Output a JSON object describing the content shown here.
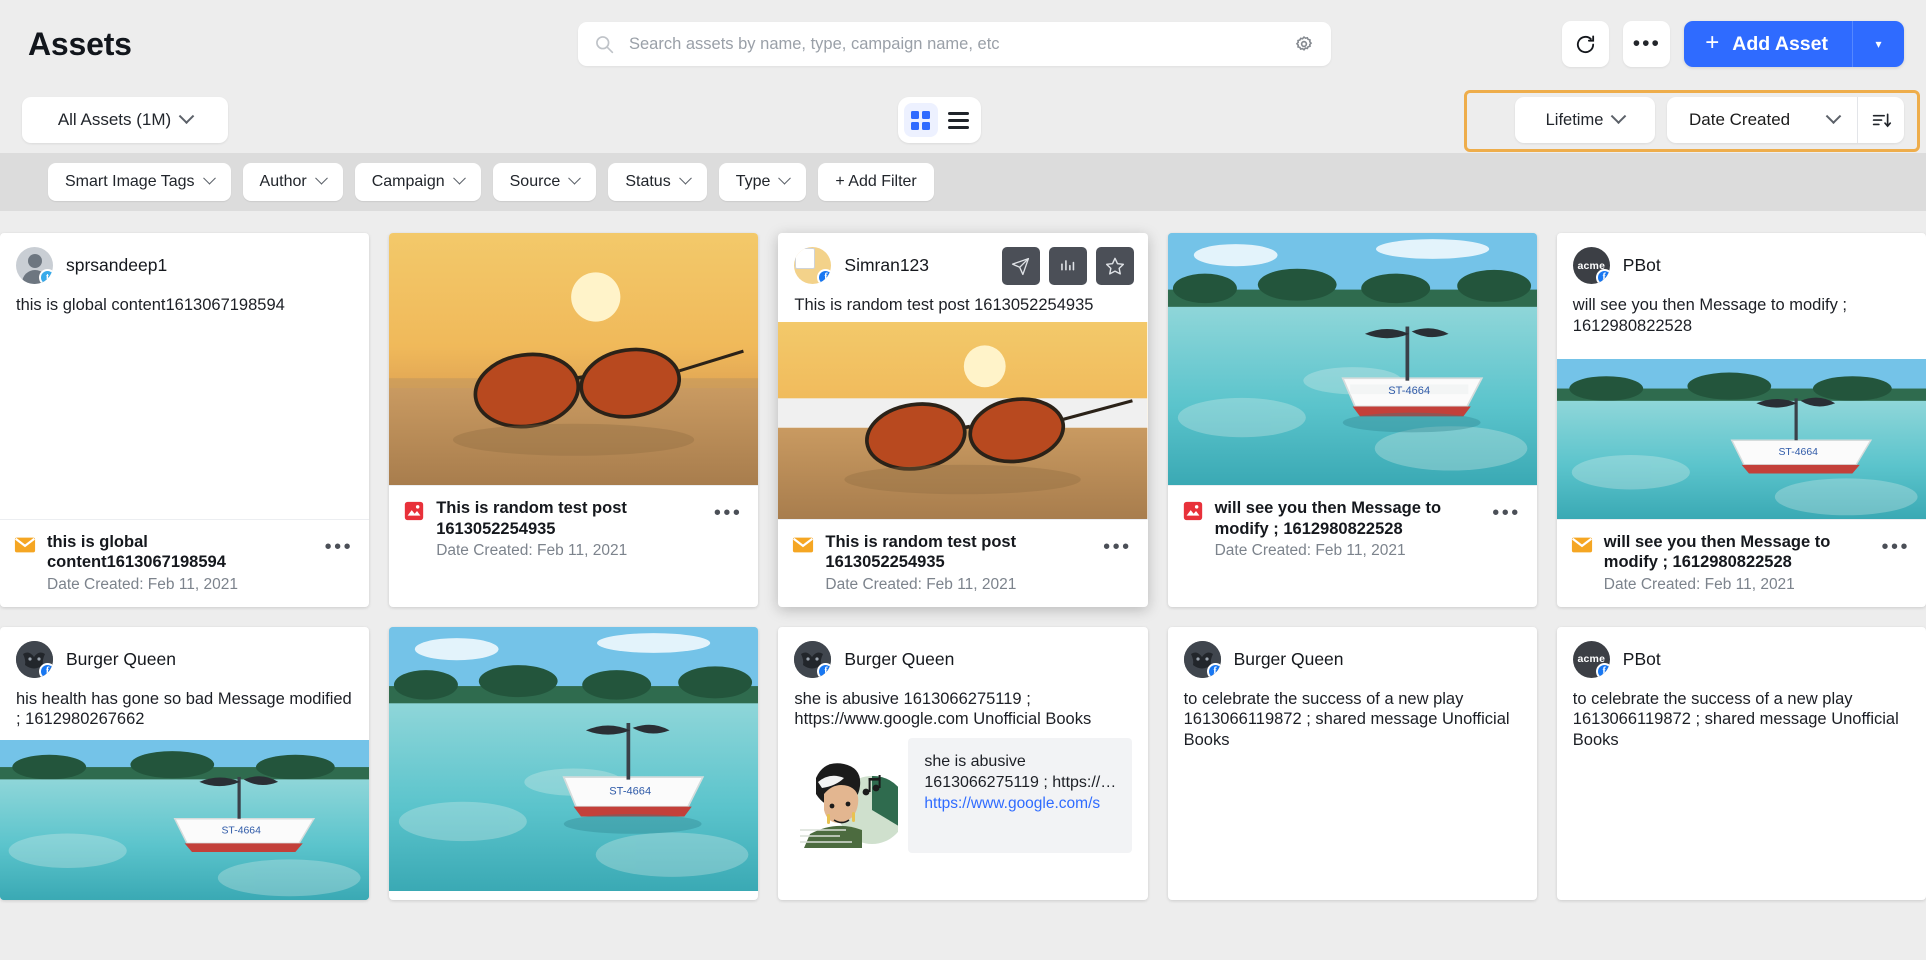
{
  "header": {
    "title": "Assets",
    "search": {
      "placeholder": "Search assets by name, type, campaign name, etc",
      "value": ""
    },
    "search_settings_icon": "gear-icon",
    "refresh_label": "refresh-icon",
    "more_label": "•••",
    "add_asset_label": "Add Asset",
    "add_asset_plus": "+",
    "add_asset_caret": "▾"
  },
  "subbar": {
    "all_assets_label": "All Assets (1M)",
    "view_grid": "grid-view",
    "view_list": "list-view",
    "lifetime_label": "Lifetime",
    "date_created_label": "Date Created",
    "sort_direction_icon": "sort-descending-icon",
    "highlight_color": "#eead4b"
  },
  "filters": [
    {
      "label": "Smart Image Tags",
      "has_chevron": true
    },
    {
      "label": "Author",
      "has_chevron": true
    },
    {
      "label": "Campaign",
      "has_chevron": true
    },
    {
      "label": "Source",
      "has_chevron": true
    },
    {
      "label": "Status",
      "has_chevron": true
    },
    {
      "label": "Type",
      "has_chevron": true
    },
    {
      "label": "+ Add Filter",
      "has_chevron": false
    }
  ],
  "cards": [
    {
      "id": "c1",
      "author": "sprsandeep1",
      "network": "twitter",
      "avatar_style": "person",
      "text": "this is global content1613067198594",
      "has_image": false,
      "footer": {
        "type_icon": "email-icon",
        "title": "this is global content1613067198594",
        "date": "Date Created: Feb 11, 2021",
        "menu": "•••"
      }
    },
    {
      "id": "c2",
      "author": "",
      "network": "",
      "avatar_style": "none",
      "text": "",
      "has_image": true,
      "image": "sunglasses-on-beach",
      "footer": {
        "type_icon": "image-icon",
        "title": "This is random test post 1613052254935",
        "date": "Date Created: Feb 11, 2021",
        "menu": "•••"
      }
    },
    {
      "id": "c3",
      "author": "Simran123",
      "network": "facebook",
      "avatar_style": "simran",
      "text": "This is random test post 1613052254935",
      "has_image": true,
      "image": "sunglasses-on-beach",
      "featured": true,
      "actions": [
        "send-icon",
        "analytics-icon",
        "star-icon"
      ],
      "footer": {
        "type_icon": "email-icon",
        "title": "This is random test post 1613052254935",
        "date": "Date Created: Feb 11, 2021",
        "menu": "•••"
      }
    },
    {
      "id": "c4",
      "author": "",
      "network": "",
      "avatar_style": "none",
      "text": "",
      "has_image": true,
      "image": "boat-on-turquoise-water",
      "footer": {
        "type_icon": "image-icon",
        "title": "will see you then Message to modify ; 1612980822528",
        "date": "Date Created: Feb 11, 2021",
        "menu": "•••"
      }
    },
    {
      "id": "c5",
      "author": "PBot",
      "network": "facebook",
      "avatar_style": "acme",
      "avatar_text": "acme",
      "text": "will see you then Message to modify ; 1612980822528",
      "has_image": true,
      "image": "boat-on-turquoise-water",
      "footer": {
        "type_icon": "email-icon",
        "title": "will see you then Message to modify ; 1612980822528",
        "date": "Date Created: Feb 11, 2021",
        "menu": "•••"
      }
    },
    {
      "id": "c6",
      "author": "Burger Queen",
      "network": "facebook",
      "avatar_style": "bat",
      "text": "his health has gone so bad Message modified ; 1612980267662",
      "has_image": true,
      "image": "boat-on-turquoise-water"
    },
    {
      "id": "c7",
      "author": "",
      "network": "",
      "avatar_style": "none",
      "text": "",
      "has_image": true,
      "image": "boat-on-turquoise-water"
    },
    {
      "id": "c8",
      "author": "Burger Queen",
      "network": "facebook",
      "avatar_style": "bat",
      "text": "she is abusive 1613066275119 ; https://www.google.com Unofficial Books",
      "has_image": true,
      "image": "doodle-woman",
      "comment": {
        "text": "she is abusive 1613066275119 ; https://…",
        "link": "https://www.google.com/s"
      }
    },
    {
      "id": "c9",
      "author": "Burger Queen",
      "network": "facebook",
      "avatar_style": "bat",
      "text": "to celebrate the success of a new play 1613066119872 ; shared message Unofficial Books",
      "has_image": false
    },
    {
      "id": "c10",
      "author": "PBot",
      "network": "facebook",
      "avatar_style": "acme",
      "avatar_text": "acme",
      "text": "to celebrate the success of a new play 1613066119872 ; shared message Unofficial Books",
      "has_image": false
    }
  ]
}
